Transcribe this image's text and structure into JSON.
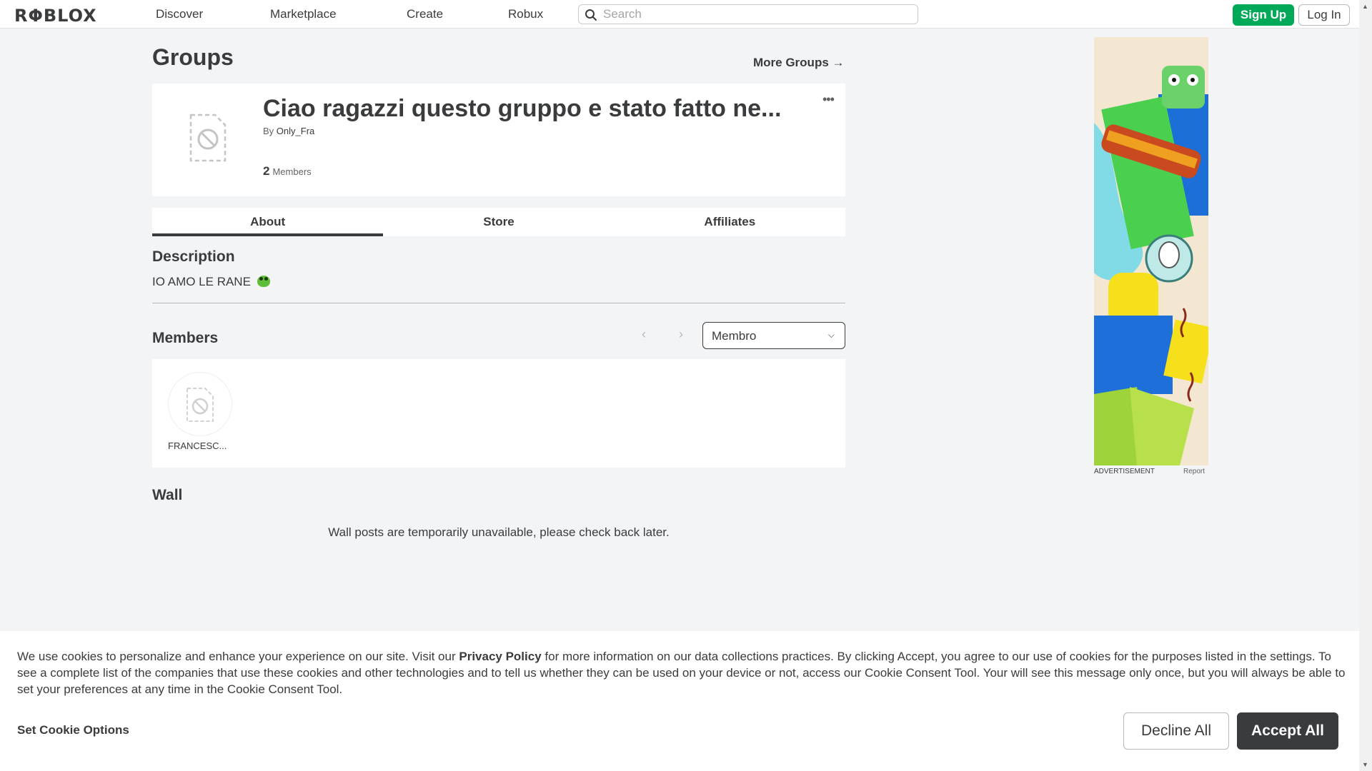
{
  "nav": {
    "logo": "RΦBLOX",
    "links": [
      "Discover",
      "Marketplace",
      "Create",
      "Robux"
    ],
    "search_placeholder": "Search",
    "signup": "Sign Up",
    "login": "Log In"
  },
  "page": {
    "title": "Groups",
    "more_groups": "More Groups →"
  },
  "group": {
    "name": "Ciao ragazzi questo gruppo e stato fatto ne...",
    "by_prefix": "By",
    "owner": "Only_Fra",
    "member_count": "2",
    "members_label": "Members",
    "more": "•••"
  },
  "tabs": [
    "About",
    "Store",
    "Affiliates"
  ],
  "description": {
    "title": "Description",
    "text": "IO AMO LE RANE"
  },
  "members": {
    "title": "Members",
    "role": "Membro",
    "list": [
      {
        "name": "FRANCESC..."
      }
    ]
  },
  "wall": {
    "title": "Wall",
    "message": "Wall posts are temporarily unavailable, please check back later."
  },
  "ad": {
    "label": "ADVERTISEMENT",
    "report": "Report"
  },
  "cookie": {
    "text_before": "We use cookies to personalize and enhance your experience on our site. Visit our ",
    "privacy_policy": "Privacy Policy",
    "text_after": " for more information on our data collections practices. By clicking Accept, you agree to our use of cookies for the purposes listed in the settings. To see a complete list of the companies that use these cookies and other technologies and to tell us whether they can be used on your device or not, access our Cookie Consent Tool. Your will see this message only once, but you will always be able to set your preferences at any time in the Cookie Consent Tool.",
    "set_options": "Set Cookie Options",
    "decline": "Decline All",
    "accept": "Accept All"
  }
}
